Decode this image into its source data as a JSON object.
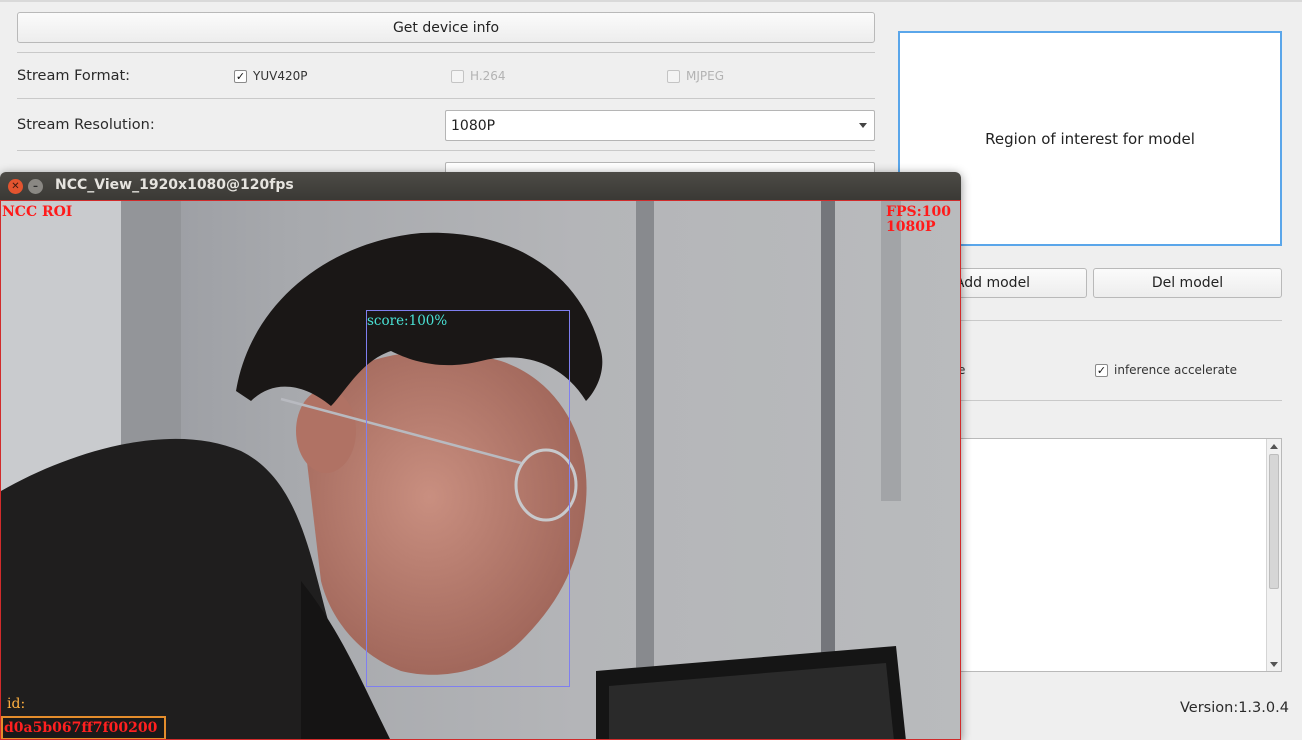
{
  "main": {
    "get_device_info_label": "Get device info",
    "stream_format_label": "Stream Format:",
    "formats": [
      {
        "label": "YUV420P",
        "checked": true,
        "enabled": true
      },
      {
        "label": "H.264",
        "checked": false,
        "enabled": false
      },
      {
        "label": "MJPEG",
        "checked": false,
        "enabled": false
      }
    ],
    "stream_resolution_label": "Stream Resolution:",
    "resolution_value": "1080P",
    "roi_placeholder": "Region of interest for model",
    "add_model_label": "Add model",
    "del_model_label": "Del model",
    "partial_checkbox_text": "e",
    "inference_accelerate_label": "inference accelerate",
    "inference_accelerate_checked": true,
    "version": "Version:1.3.0.4"
  },
  "ncc_view": {
    "title": "NCC_View_1920x1080@120fps",
    "close_glyph": "✕",
    "minimize_glyph": "–",
    "roi_text": "NCC ROI",
    "fps_text": "FPS:100",
    "resolution_text": "1080P",
    "score_text": "score:100%",
    "id_label": "id:",
    "id_value": "d0a5b067ff7f00200",
    "colors": {
      "overlay_red": "#ff1a1a",
      "face_box": "#7f7ff0",
      "score": "#49e1d4",
      "id_border": "#e48d2c"
    }
  },
  "checkmark_glyph": "✓"
}
